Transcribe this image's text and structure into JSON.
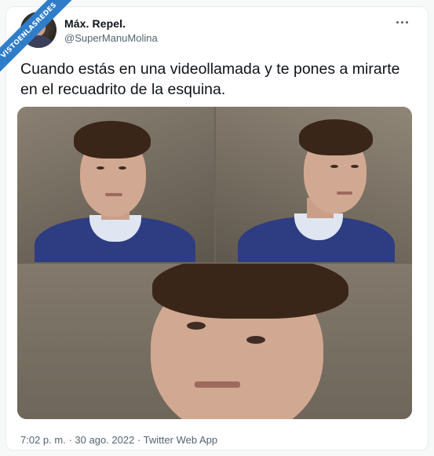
{
  "watermark": {
    "text": "VISTOENLASREDES"
  },
  "tweet": {
    "display_name": "Máx. Repel.",
    "handle": "@SuperManuMolina",
    "text": "Cuando estás en una videollamada y te pones a mirarte en el recuadrito de la esquina.",
    "time": "7:02 p. m.",
    "separator": "·",
    "date": "30 ago. 2022",
    "source": "Twitter Web App"
  },
  "icons": {
    "more": "more-horizontal-icon",
    "avatar": "profile-avatar"
  },
  "colors": {
    "text": "#0f1419",
    "secondary": "#536471",
    "watermark": "#2f7dc9",
    "sweater": "#2e3c82"
  }
}
